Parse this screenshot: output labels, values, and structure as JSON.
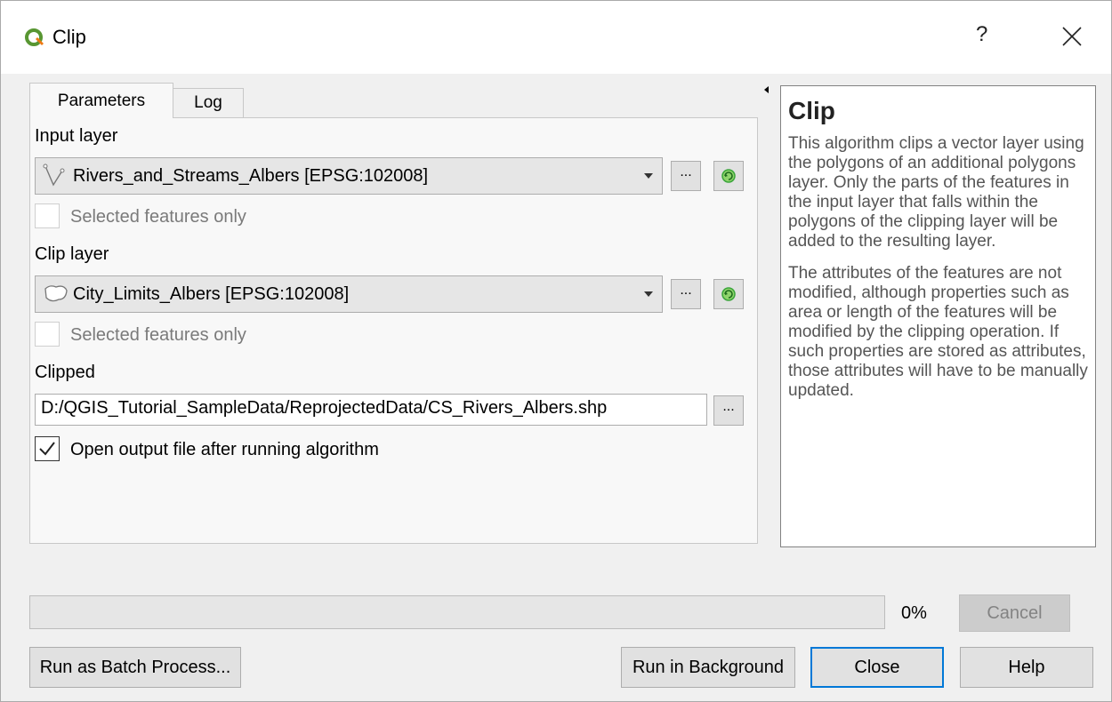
{
  "window": {
    "title": "Clip",
    "help_button": "?",
    "close_icon": "close-icon",
    "app_icon": "qgis-logo-icon"
  },
  "tabs": [
    {
      "label": "Parameters",
      "active": true
    },
    {
      "label": "Log",
      "active": false
    }
  ],
  "parameters": {
    "input_layer": {
      "label": "Input layer",
      "value": "Rivers_and_Streams_Albers [EPSG:102008]",
      "icon": "line-layer-icon",
      "browse_label": "...",
      "selected_only_label": "Selected features only",
      "selected_only_checked": false
    },
    "clip_layer": {
      "label": "Clip layer",
      "value": "City_Limits_Albers [EPSG:102008]",
      "icon": "polygon-layer-icon",
      "browse_label": "...",
      "selected_only_label": "Selected features only",
      "selected_only_checked": false
    },
    "clipped": {
      "label": "Clipped",
      "value": "D:/QGIS_Tutorial_SampleData/ReprojectedData/CS_Rivers_Albers.shp",
      "browse_label": "..."
    },
    "open_output": {
      "label": "Open output file after running algorithm",
      "checked": true
    }
  },
  "help": {
    "title": "Clip",
    "paragraphs": [
      "This algorithm clips a vector layer using the polygons of an additional polygons layer. Only the parts of the features in the input layer that falls within the polygons of the clipping layer will be added to the resulting layer.",
      "The attributes of the features are not modified, although properties such as area or length of the features will be modified by the clipping operation. If such properties are stored as attributes, those attributes will have to be manually updated."
    ]
  },
  "progress": {
    "percent": 0,
    "label": "0%"
  },
  "buttons": {
    "cancel": "Cancel",
    "batch": "Run as Batch Process...",
    "background": "Run in Background",
    "close": "Close",
    "help": "Help"
  },
  "colors": {
    "accent": "#0078d7",
    "refresh_green": "#3aa53a"
  }
}
